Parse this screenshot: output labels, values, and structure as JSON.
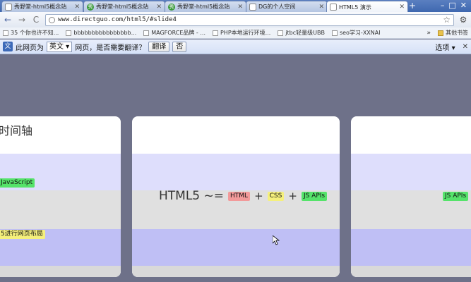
{
  "tabs": [
    {
      "label": "秀野堂-html5概念站",
      "favicon": "doc-icon"
    },
    {
      "label": "秀野堂-html5概念站",
      "favicon": "green-icon"
    },
    {
      "label": "秀野堂-html5概念站",
      "favicon": "green-icon"
    },
    {
      "label": "DG的个人空间",
      "favicon": "doc-icon"
    },
    {
      "label": "HTML5 演示",
      "favicon": "doc-icon",
      "active": true
    }
  ],
  "new_tab": "+",
  "window_buttons": {
    "minimize": "–",
    "maximize": "□",
    "close": "✕"
  },
  "toolbar": {
    "back": "←",
    "forward": "→",
    "reload": "C",
    "url": "www.directguo.com/html5/#slide4",
    "star": "☆",
    "wrench": "🔧"
  },
  "bookmarks": {
    "items": [
      "35 个你也许不知...",
      "bbbbbbbbbbbbbbbb...",
      "MAGFORCE品牌 - ...",
      "PHP本地运行环境...",
      "jtbc轻量级UBB",
      "seo学习-XXNAI"
    ],
    "more": "»",
    "other": "其他书签"
  },
  "translate_bar": {
    "prefix": "此网页为",
    "language": "英文 ▾",
    "question": "网页，是否需要翻译？",
    "translate_btn": "翻译",
    "no_btn": "否",
    "options": "选项 ▾",
    "close": "✕"
  },
  "slides": {
    "left": {
      "title": "时间轴",
      "tag1": "JavaScript",
      "tag2": "5进行网页布局"
    },
    "middle": {
      "lead": "HTML5 ~=",
      "html": "HTML",
      "plus1": "+",
      "css": "CSS",
      "plus2": "+",
      "js": "JS APIs"
    },
    "right": {
      "tag": "JS APIs"
    }
  },
  "colors": {
    "backdrop": "#6e7189",
    "green_tag": "#55e36a",
    "yellow_tag": "#f5f07c",
    "red_tag": "#f29a9a"
  }
}
